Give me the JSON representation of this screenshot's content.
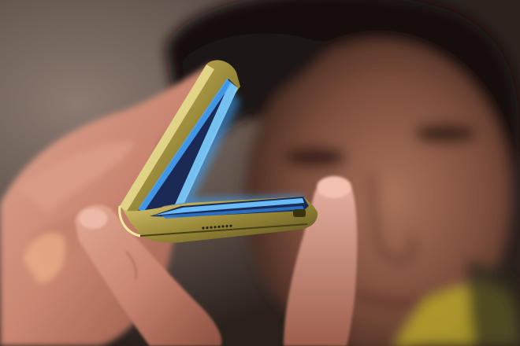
{
  "image": {
    "subject": "",
    "caption": ""
  },
  "palette": {
    "background": "#5e524b",
    "hair": "#141110",
    "skin_face": "#8a5a45",
    "skin_hand": "#c98a72",
    "phone_frame": "#b9a550",
    "screen_glow": "#3fa8ff",
    "shirt": "#b8a32a"
  }
}
